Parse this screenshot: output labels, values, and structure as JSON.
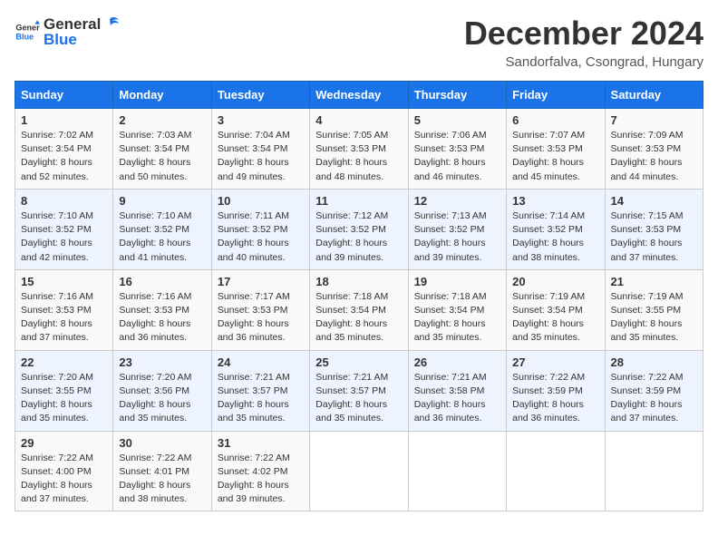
{
  "header": {
    "logo_general": "General",
    "logo_blue": "Blue",
    "title": "December 2024",
    "subtitle": "Sandorfalva, Csongrad, Hungary"
  },
  "weekdays": [
    "Sunday",
    "Monday",
    "Tuesday",
    "Wednesday",
    "Thursday",
    "Friday",
    "Saturday"
  ],
  "weeks": [
    [
      {
        "day": "1",
        "sunrise": "Sunrise: 7:02 AM",
        "sunset": "Sunset: 3:54 PM",
        "daylight": "Daylight: 8 hours and 52 minutes."
      },
      {
        "day": "2",
        "sunrise": "Sunrise: 7:03 AM",
        "sunset": "Sunset: 3:54 PM",
        "daylight": "Daylight: 8 hours and 50 minutes."
      },
      {
        "day": "3",
        "sunrise": "Sunrise: 7:04 AM",
        "sunset": "Sunset: 3:54 PM",
        "daylight": "Daylight: 8 hours and 49 minutes."
      },
      {
        "day": "4",
        "sunrise": "Sunrise: 7:05 AM",
        "sunset": "Sunset: 3:53 PM",
        "daylight": "Daylight: 8 hours and 48 minutes."
      },
      {
        "day": "5",
        "sunrise": "Sunrise: 7:06 AM",
        "sunset": "Sunset: 3:53 PM",
        "daylight": "Daylight: 8 hours and 46 minutes."
      },
      {
        "day": "6",
        "sunrise": "Sunrise: 7:07 AM",
        "sunset": "Sunset: 3:53 PM",
        "daylight": "Daylight: 8 hours and 45 minutes."
      },
      {
        "day": "7",
        "sunrise": "Sunrise: 7:09 AM",
        "sunset": "Sunset: 3:53 PM",
        "daylight": "Daylight: 8 hours and 44 minutes."
      }
    ],
    [
      {
        "day": "8",
        "sunrise": "Sunrise: 7:10 AM",
        "sunset": "Sunset: 3:52 PM",
        "daylight": "Daylight: 8 hours and 42 minutes."
      },
      {
        "day": "9",
        "sunrise": "Sunrise: 7:10 AM",
        "sunset": "Sunset: 3:52 PM",
        "daylight": "Daylight: 8 hours and 41 minutes."
      },
      {
        "day": "10",
        "sunrise": "Sunrise: 7:11 AM",
        "sunset": "Sunset: 3:52 PM",
        "daylight": "Daylight: 8 hours and 40 minutes."
      },
      {
        "day": "11",
        "sunrise": "Sunrise: 7:12 AM",
        "sunset": "Sunset: 3:52 PM",
        "daylight": "Daylight: 8 hours and 39 minutes."
      },
      {
        "day": "12",
        "sunrise": "Sunrise: 7:13 AM",
        "sunset": "Sunset: 3:52 PM",
        "daylight": "Daylight: 8 hours and 39 minutes."
      },
      {
        "day": "13",
        "sunrise": "Sunrise: 7:14 AM",
        "sunset": "Sunset: 3:52 PM",
        "daylight": "Daylight: 8 hours and 38 minutes."
      },
      {
        "day": "14",
        "sunrise": "Sunrise: 7:15 AM",
        "sunset": "Sunset: 3:53 PM",
        "daylight": "Daylight: 8 hours and 37 minutes."
      }
    ],
    [
      {
        "day": "15",
        "sunrise": "Sunrise: 7:16 AM",
        "sunset": "Sunset: 3:53 PM",
        "daylight": "Daylight: 8 hours and 37 minutes."
      },
      {
        "day": "16",
        "sunrise": "Sunrise: 7:16 AM",
        "sunset": "Sunset: 3:53 PM",
        "daylight": "Daylight: 8 hours and 36 minutes."
      },
      {
        "day": "17",
        "sunrise": "Sunrise: 7:17 AM",
        "sunset": "Sunset: 3:53 PM",
        "daylight": "Daylight: 8 hours and 36 minutes."
      },
      {
        "day": "18",
        "sunrise": "Sunrise: 7:18 AM",
        "sunset": "Sunset: 3:54 PM",
        "daylight": "Daylight: 8 hours and 35 minutes."
      },
      {
        "day": "19",
        "sunrise": "Sunrise: 7:18 AM",
        "sunset": "Sunset: 3:54 PM",
        "daylight": "Daylight: 8 hours and 35 minutes."
      },
      {
        "day": "20",
        "sunrise": "Sunrise: 7:19 AM",
        "sunset": "Sunset: 3:54 PM",
        "daylight": "Daylight: 8 hours and 35 minutes."
      },
      {
        "day": "21",
        "sunrise": "Sunrise: 7:19 AM",
        "sunset": "Sunset: 3:55 PM",
        "daylight": "Daylight: 8 hours and 35 minutes."
      }
    ],
    [
      {
        "day": "22",
        "sunrise": "Sunrise: 7:20 AM",
        "sunset": "Sunset: 3:55 PM",
        "daylight": "Daylight: 8 hours and 35 minutes."
      },
      {
        "day": "23",
        "sunrise": "Sunrise: 7:20 AM",
        "sunset": "Sunset: 3:56 PM",
        "daylight": "Daylight: 8 hours and 35 minutes."
      },
      {
        "day": "24",
        "sunrise": "Sunrise: 7:21 AM",
        "sunset": "Sunset: 3:57 PM",
        "daylight": "Daylight: 8 hours and 35 minutes."
      },
      {
        "day": "25",
        "sunrise": "Sunrise: 7:21 AM",
        "sunset": "Sunset: 3:57 PM",
        "daylight": "Daylight: 8 hours and 35 minutes."
      },
      {
        "day": "26",
        "sunrise": "Sunrise: 7:21 AM",
        "sunset": "Sunset: 3:58 PM",
        "daylight": "Daylight: 8 hours and 36 minutes."
      },
      {
        "day": "27",
        "sunrise": "Sunrise: 7:22 AM",
        "sunset": "Sunset: 3:59 PM",
        "daylight": "Daylight: 8 hours and 36 minutes."
      },
      {
        "day": "28",
        "sunrise": "Sunrise: 7:22 AM",
        "sunset": "Sunset: 3:59 PM",
        "daylight": "Daylight: 8 hours and 37 minutes."
      }
    ],
    [
      {
        "day": "29",
        "sunrise": "Sunrise: 7:22 AM",
        "sunset": "Sunset: 4:00 PM",
        "daylight": "Daylight: 8 hours and 37 minutes."
      },
      {
        "day": "30",
        "sunrise": "Sunrise: 7:22 AM",
        "sunset": "Sunset: 4:01 PM",
        "daylight": "Daylight: 8 hours and 38 minutes."
      },
      {
        "day": "31",
        "sunrise": "Sunrise: 7:22 AM",
        "sunset": "Sunset: 4:02 PM",
        "daylight": "Daylight: 8 hours and 39 minutes."
      },
      null,
      null,
      null,
      null
    ]
  ]
}
